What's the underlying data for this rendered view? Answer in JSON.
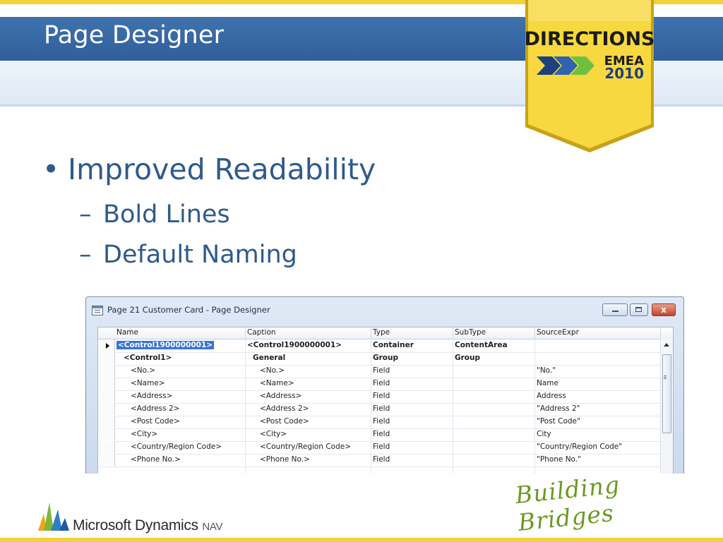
{
  "slide": {
    "title": "Page Designer",
    "bullets": {
      "main": "Improved Readability",
      "sub": [
        "Bold Lines",
        "Default Naming"
      ]
    }
  },
  "badge": {
    "line1": "DIRECTIONS",
    "line2": "EMEA",
    "line3": "2010"
  },
  "window": {
    "title": "Page 21 Customer Card - Page Designer",
    "close_glyph": "x",
    "columns": [
      "Name",
      "Caption",
      "Type",
      "SubType",
      "SourceExpr"
    ],
    "rows": [
      {
        "name": "<Control1900000001>",
        "caption": "<Control1900000001>",
        "type": "Container",
        "subtype": "ContentArea",
        "source": "",
        "bold": true,
        "selected": true,
        "indent": 0
      },
      {
        "name": "<Control1>",
        "caption": "General",
        "type": "Group",
        "subtype": "Group",
        "source": "",
        "bold": true,
        "selected": false,
        "indent": 1
      },
      {
        "name": "<No.>",
        "caption": "<No.>",
        "type": "Field",
        "subtype": "",
        "source": "\"No.\"",
        "bold": false,
        "selected": false,
        "indent": 2
      },
      {
        "name": "<Name>",
        "caption": "<Name>",
        "type": "Field",
        "subtype": "",
        "source": "Name",
        "bold": false,
        "selected": false,
        "indent": 2
      },
      {
        "name": "<Address>",
        "caption": "<Address>",
        "type": "Field",
        "subtype": "",
        "source": "Address",
        "bold": false,
        "selected": false,
        "indent": 2
      },
      {
        "name": "<Address 2>",
        "caption": "<Address 2>",
        "type": "Field",
        "subtype": "",
        "source": "\"Address 2\"",
        "bold": false,
        "selected": false,
        "indent": 2
      },
      {
        "name": "<Post Code>",
        "caption": "<Post Code>",
        "type": "Field",
        "subtype": "",
        "source": "\"Post Code\"",
        "bold": false,
        "selected": false,
        "indent": 2
      },
      {
        "name": "<City>",
        "caption": "<City>",
        "type": "Field",
        "subtype": "",
        "source": "City",
        "bold": false,
        "selected": false,
        "indent": 2
      },
      {
        "name": "<Country/Region Code>",
        "caption": "<Country/Region Code>",
        "type": "Field",
        "subtype": "",
        "source": "\"Country/Region Code\"",
        "bold": false,
        "selected": false,
        "indent": 2
      },
      {
        "name": "<Phone No.>",
        "caption": "<Phone No.>",
        "type": "Field",
        "subtype": "",
        "source": "\"Phone No.\"",
        "bold": false,
        "selected": false,
        "indent": 2
      }
    ]
  },
  "footer": {
    "brand": "Microsoft Dynamics",
    "brand_suffix": "NAV",
    "tagline": "Building Bridges"
  },
  "colors": {
    "title_band": "#2f5f9c",
    "accent_yellow": "#f6d23a",
    "text_blue": "#2f5a8c",
    "tagline_green": "#6c9a22"
  }
}
